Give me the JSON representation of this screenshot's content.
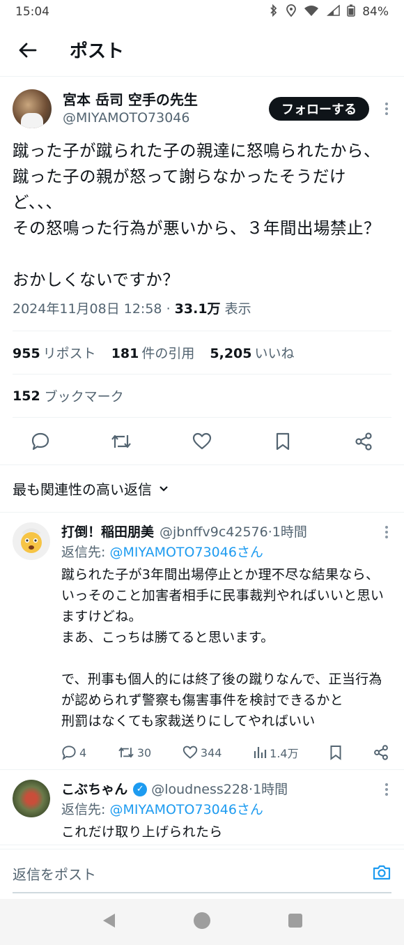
{
  "status": {
    "time": "15:04",
    "battery": "84%"
  },
  "header": {
    "title": "ポスト"
  },
  "tweet": {
    "name": "宮本 岳司 空手の先生",
    "handle": "@MIYAMOTO73046",
    "follow_label": "フォローする",
    "text": "蹴った子が蹴られた子の親達に怒鳴られたから、蹴った子の親が怒って謝らなかったそうだけど、、、\nその怒鳴った行為が悪いから、３年間出場禁止？\n\nおかしくないですか？",
    "datetime": "2024年11月08日 12:58",
    "views_count": "33.1万",
    "views_label": "表示",
    "reposts_count": "955",
    "reposts_label": "リポスト",
    "quotes_count": "181",
    "quotes_label": "件の引用",
    "likes_count": "5,205",
    "likes_label": "いいね",
    "bookmarks_count": "152",
    "bookmarks_label": "ブックマーク"
  },
  "sort": {
    "label": "最も関連性の高い返信"
  },
  "replies": [
    {
      "name": "打倒！稲田朋美",
      "handle": "@jbnffv9c42576",
      "time": "1時間",
      "reply_to_prefix": "返信先: ",
      "reply_to_handle": "@MIYAMOTO73046さん",
      "text": "蹴られた子が3年間出場停止とか理不尽な結果なら、いっそのこと加害者相手に民事裁判やればいいと思いますけどね。\nまあ、こっちは勝てると思います。\n\nで、刑事も個人的には終了後の蹴りなんで、正当行為が認められず警察も傷害事件を検討できるかと\n刑罰はなくても家裁送りにしてやればいい",
      "replies": "4",
      "reposts": "30",
      "likes": "344",
      "views": "1.4万"
    },
    {
      "name": "こぶちゃん",
      "handle": "@loudness228",
      "time": "1時間",
      "reply_to_prefix": "返信先: ",
      "reply_to_handle": "@MIYAMOTO73046さん",
      "text": "これだけ取り上げられたら"
    }
  ],
  "compose": {
    "placeholder": "返信をポスト"
  },
  "colors": {
    "accent": "#1d9bf0",
    "text": "#0f1419",
    "muted": "#536471"
  }
}
